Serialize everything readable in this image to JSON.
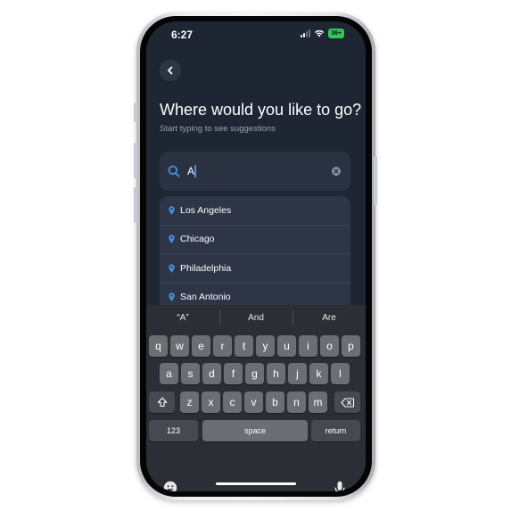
{
  "status_bar": {
    "time": "6:27",
    "battery": "36+"
  },
  "header": {
    "title": "Where would you like to go?",
    "subtitle": "Start typing to see suggestions"
  },
  "search": {
    "value": "A"
  },
  "suggestions": [
    {
      "label": "Los Angeles"
    },
    {
      "label": "Chicago"
    },
    {
      "label": "Philadelphia"
    },
    {
      "label": "San Antonio"
    }
  ],
  "keyboard": {
    "predictions": [
      "“A”",
      "And",
      "Are"
    ],
    "row1": [
      "q",
      "w",
      "e",
      "r",
      "t",
      "y",
      "u",
      "i",
      "o",
      "p"
    ],
    "row2": [
      "a",
      "s",
      "d",
      "f",
      "g",
      "h",
      "j",
      "k",
      "l"
    ],
    "row3": [
      "z",
      "x",
      "c",
      "v",
      "b",
      "n",
      "m"
    ],
    "numbers_label": "123",
    "space_label": "space",
    "return_label": "return"
  },
  "colors": {
    "accent": "#4a90e2",
    "background": "#1e2533",
    "battery": "#34c759"
  }
}
